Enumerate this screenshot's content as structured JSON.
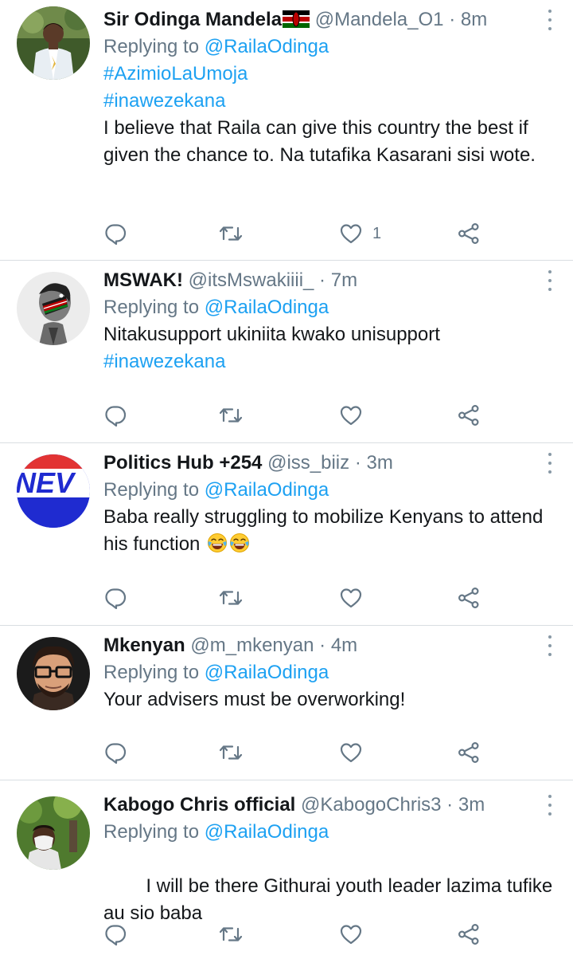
{
  "tweets": [
    {
      "name": "Sir Odinga Mandela",
      "handle": "@Mandela_O1",
      "time": "8m",
      "reply_prefix": "Replying to",
      "reply_to": "@RailaOdinga",
      "hashtags": [
        "#AzimioLaUmoja",
        "#inawezekana"
      ],
      "text": "I believe that Raila can give this country the best if given the chance to. Na tutafika Kasarani sisi wote.",
      "likes": "1",
      "avatar_icon": "profile-photo-man-white-shirt"
    },
    {
      "name": "MSWAK!",
      "handle": "@itsMswakiiii_",
      "time": "7m",
      "reply_prefix": "Replying to",
      "reply_to": "@RailaOdinga",
      "text": "Nitakusupport ukiniita kwako unisupport",
      "hashtag_after": "#inawezekana",
      "likes": "",
      "avatar_icon": "kenya-flag-face-illustration"
    },
    {
      "name": "Politics Hub +254",
      "handle": "@iss_biiz",
      "time": "3m",
      "reply_prefix": "Replying to",
      "reply_to": "@RailaOdinga",
      "text": "Baba really struggling to mobilize Kenyans to attend his function",
      "emoji": "tears-of-joy-emoji",
      "likes": "",
      "avatar_icon": "news-logo",
      "avatar_text": "NEV"
    },
    {
      "name": "Mkenyan",
      "handle": "@m_mkenyan",
      "time": "4m",
      "reply_prefix": "Replying to",
      "reply_to": "@RailaOdinga",
      "text": "Your advisers must be overworking!",
      "likes": "",
      "avatar_icon": "cartoon-man-glasses"
    },
    {
      "name": "Kabogo Chris official",
      "handle": "@KabogoChris3",
      "time": "3m",
      "reply_prefix": "Replying to",
      "reply_to": "@RailaOdinga",
      "text": "I will be there Githurai youth leader lazima tufike  au sio baba",
      "likes": "",
      "avatar_icon": "profile-photo-masked-man"
    }
  ],
  "colors": {
    "link": "#1da1f2",
    "muted": "#657786",
    "divider": "#d9dee2",
    "text": "#14171a"
  },
  "icons": {
    "reply": "reply-icon",
    "retweet": "retweet-icon",
    "like": "heart-icon",
    "share": "share-icon",
    "more": "more-vertical-icon"
  }
}
